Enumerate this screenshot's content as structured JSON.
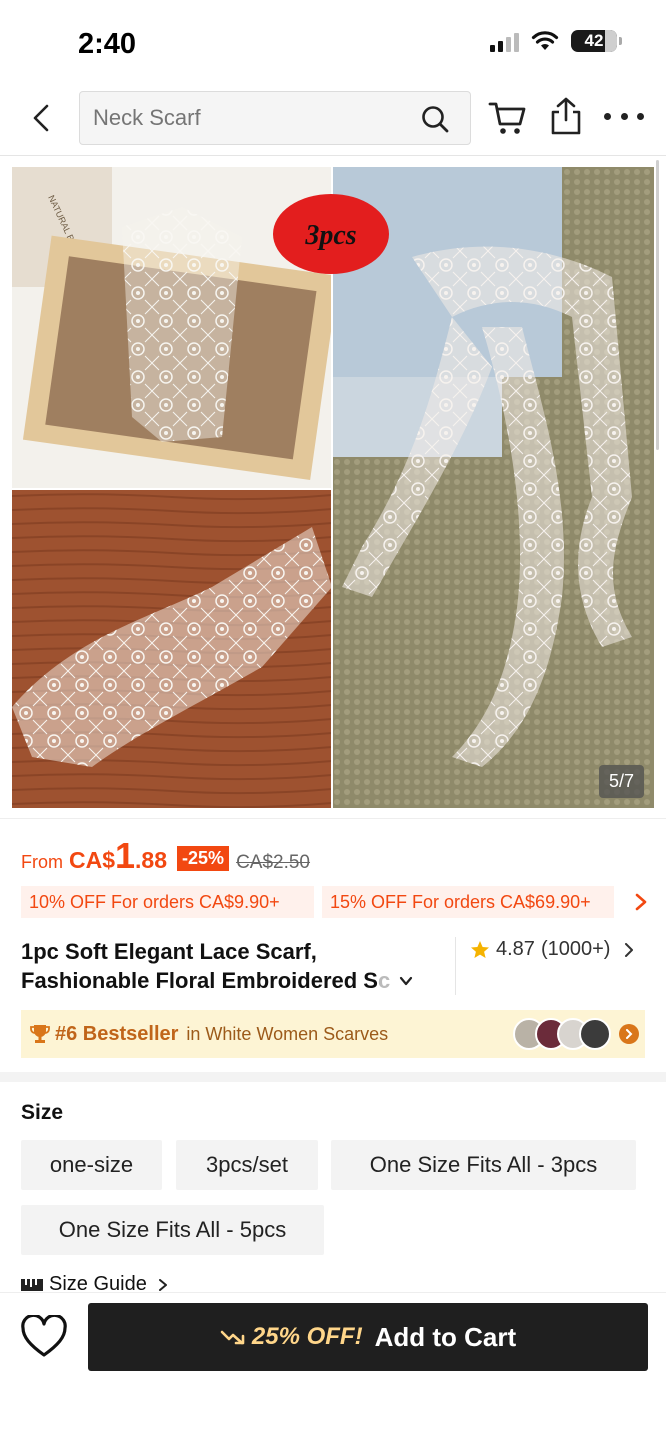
{
  "status_bar": {
    "time": "2:40",
    "battery": "42"
  },
  "header": {
    "search_placeholder": "Neck Scarf",
    "icons": [
      "back-arrow-icon",
      "search-icon",
      "cart-icon",
      "share-icon",
      "more-icon"
    ]
  },
  "gallery": {
    "badge": "3pcs",
    "watermark": "NATURAL BEAUTY",
    "counter": "5/7"
  },
  "price": {
    "from": "From",
    "currency": "CA$",
    "integer": "1",
    "decimal": ".88",
    "discount": "-25%",
    "original": "CA$2.50"
  },
  "coupons": [
    "10% OFF For orders CA$9.90+",
    "15% OFF For orders CA$69.90+"
  ],
  "product": {
    "title_line1": "1pc Soft Elegant Lace Scarf,",
    "title_line2": "Fashionable Floral Embroidered S",
    "title_fade": "c",
    "rating": "4.87",
    "reviews": "(1000+)"
  },
  "bestseller": {
    "rank": "#6 Bestseller",
    "category": "in White Women Scarves"
  },
  "size": {
    "label": "Size",
    "options": [
      "one-size",
      "3pcs/set",
      "One Size Fits All - 3pcs",
      "One Size Fits All - 5pcs"
    ],
    "guide": "Size Guide"
  },
  "cart": {
    "promo": "25% OFF!",
    "label": "Add to Cart"
  },
  "colors": {
    "accent": "#f24811",
    "coupon_bg": "#fff1ec",
    "bestseller_bg": "#fdf4d4",
    "button_bg": "#1f1f1f"
  }
}
